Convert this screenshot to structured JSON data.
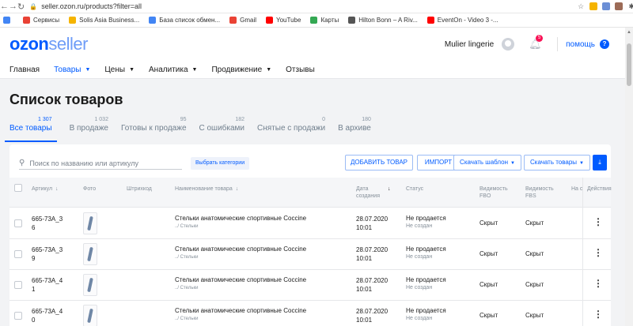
{
  "browser": {
    "url": "seller.ozon.ru/products?filter=all",
    "bookmarks": [
      {
        "label": "Сервисы",
        "color": "#e94235"
      },
      {
        "label": "Solis Asia Business...",
        "color": "#f5b400"
      },
      {
        "label": "База список обмен...",
        "color": "#4285f4"
      },
      {
        "label": "Gmail",
        "color": "#ea4335"
      },
      {
        "label": "YouTube",
        "color": "#ff0000"
      },
      {
        "label": "Карты",
        "color": "#34a853"
      },
      {
        "label": "Hilton Bonn – A Riv...",
        "color": "#555555"
      },
      {
        "label": "EventOn - Video 3 -...",
        "color": "#ff0000"
      }
    ]
  },
  "header": {
    "logo_primary": "ozon",
    "logo_secondary": "seller",
    "seller_name": "Mulier lingerie",
    "notifications_count": "5",
    "help_label": "помощь",
    "help_symbol": "?"
  },
  "nav": [
    {
      "label": "Главная",
      "dropdown": false,
      "active": false
    },
    {
      "label": "Товары",
      "dropdown": true,
      "active": true
    },
    {
      "label": "Цены",
      "dropdown": true,
      "active": false
    },
    {
      "label": "Аналитика",
      "dropdown": true,
      "active": false
    },
    {
      "label": "Продвижение",
      "dropdown": true,
      "active": false
    },
    {
      "label": "Отзывы",
      "dropdown": false,
      "active": false
    }
  ],
  "page": {
    "title": "Список товаров",
    "tabs": [
      {
        "label": "Все товары",
        "count": "1 307",
        "active": true
      },
      {
        "label": "В продаже",
        "count": "1 032",
        "active": false
      },
      {
        "label": "Готовы к продаже",
        "count": "95",
        "active": false
      },
      {
        "label": "С ошибками",
        "count": "182",
        "active": false
      },
      {
        "label": "Снятые с продажи",
        "count": "0",
        "active": false
      },
      {
        "label": "В архиве",
        "count": "180",
        "active": false
      }
    ]
  },
  "toolbar": {
    "search_placeholder": "Поиск по названию или артикулу",
    "category_button": "Выбрать категории",
    "add_button": "ДОБАВИТЬ ТОВАР",
    "import_button": "ИМПОРТ",
    "template_button": "Скачать шаблон",
    "download_button": "Скачать товары"
  },
  "table": {
    "columns": {
      "article": "Артикул",
      "photo": "Фото",
      "barcode": "Штрихкод",
      "name": "Наименование товара",
      "date_l1": "Дата",
      "date_l2": "создания",
      "status": "Статус",
      "vis_fbo_l1": "Видимость",
      "vis_fbo_l2": "FBO",
      "vis_fbs_l1": "Видимость",
      "vis_fbs_l2": "FBS",
      "extra": "На с",
      "actions": "Действия"
    },
    "rows": [
      {
        "art_l1": "665-73А_3",
        "art_l2": "6",
        "name": "Стельки анатомические спортивные Coccine",
        "path": "../ Стельки",
        "date": "28.07.2020",
        "time": "10:01",
        "status": "Не продается",
        "substatus": "Не создан",
        "fbo": "Скрыт",
        "fbs": "Скрыт"
      },
      {
        "art_l1": "665-73А_3",
        "art_l2": "9",
        "name": "Стельки анатомические спортивные Coccine",
        "path": "../ Стельки",
        "date": "28.07.2020",
        "time": "10:01",
        "status": "Не продается",
        "substatus": "Не создан",
        "fbo": "Скрыт",
        "fbs": "Скрыт"
      },
      {
        "art_l1": "665-73А_4",
        "art_l2": "1",
        "name": "Стельки анатомические спортивные Coccine",
        "path": "../ Стельки",
        "date": "28.07.2020",
        "time": "10:01",
        "status": "Не продается",
        "substatus": "Не создан",
        "fbo": "Скрыт",
        "fbs": "Скрыт"
      },
      {
        "art_l1": "665-73А_4",
        "art_l2": "0",
        "name": "Стельки анатомические спортивные Coccine",
        "path": "../ Стельки",
        "date": "28.07.2020",
        "time": "10:01",
        "status": "Не продается",
        "substatus": "Не создан",
        "fbo": "Скрыт",
        "fbs": "Скрыт"
      }
    ]
  }
}
